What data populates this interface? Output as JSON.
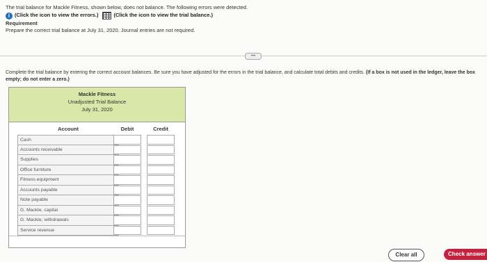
{
  "intro": {
    "line1": "The trial balance for Mackle Fitness, shown below, does not balance. The following errors were detected.",
    "errors_link": "(Click the icon to view the errors.)",
    "tb_link": "(Click the icon to view the trial balance.)",
    "requirement_heading": "Requirement",
    "requirement_text": "Prepare the correct trial balance at July 31, 2020. Journal entries are not required."
  },
  "instructions": {
    "text": "Complete the trial balance by entering the correct account balances. Be sure you have adjusted for the errors in the trial balance, and calculate total debits and credits.",
    "bold": "(If a box is not used in the ledger, leave the box empty; do not enter a zero.)"
  },
  "trial_balance": {
    "company": "Mackle Fitness",
    "title": "Unadjusted Trial Balance",
    "date": "July 31, 2020",
    "col_account": "Account",
    "col_debit": "Debit",
    "col_credit": "Credit",
    "accounts": [
      "Cash",
      "Accounts receivable",
      "Supplies",
      "Office furniture",
      "Fitness equipment",
      "Accounts payable",
      "Note payable",
      "G. Mackle, capital",
      "G. Mackle, withdrawals",
      "Service revenue"
    ]
  },
  "buttons": {
    "clear_all": "Clear all",
    "check_answer": "Check answer"
  },
  "colors": {
    "header_bg": "#d9e8a8",
    "check_btn": "#c6213d",
    "info_icon": "#1f6fb8"
  }
}
